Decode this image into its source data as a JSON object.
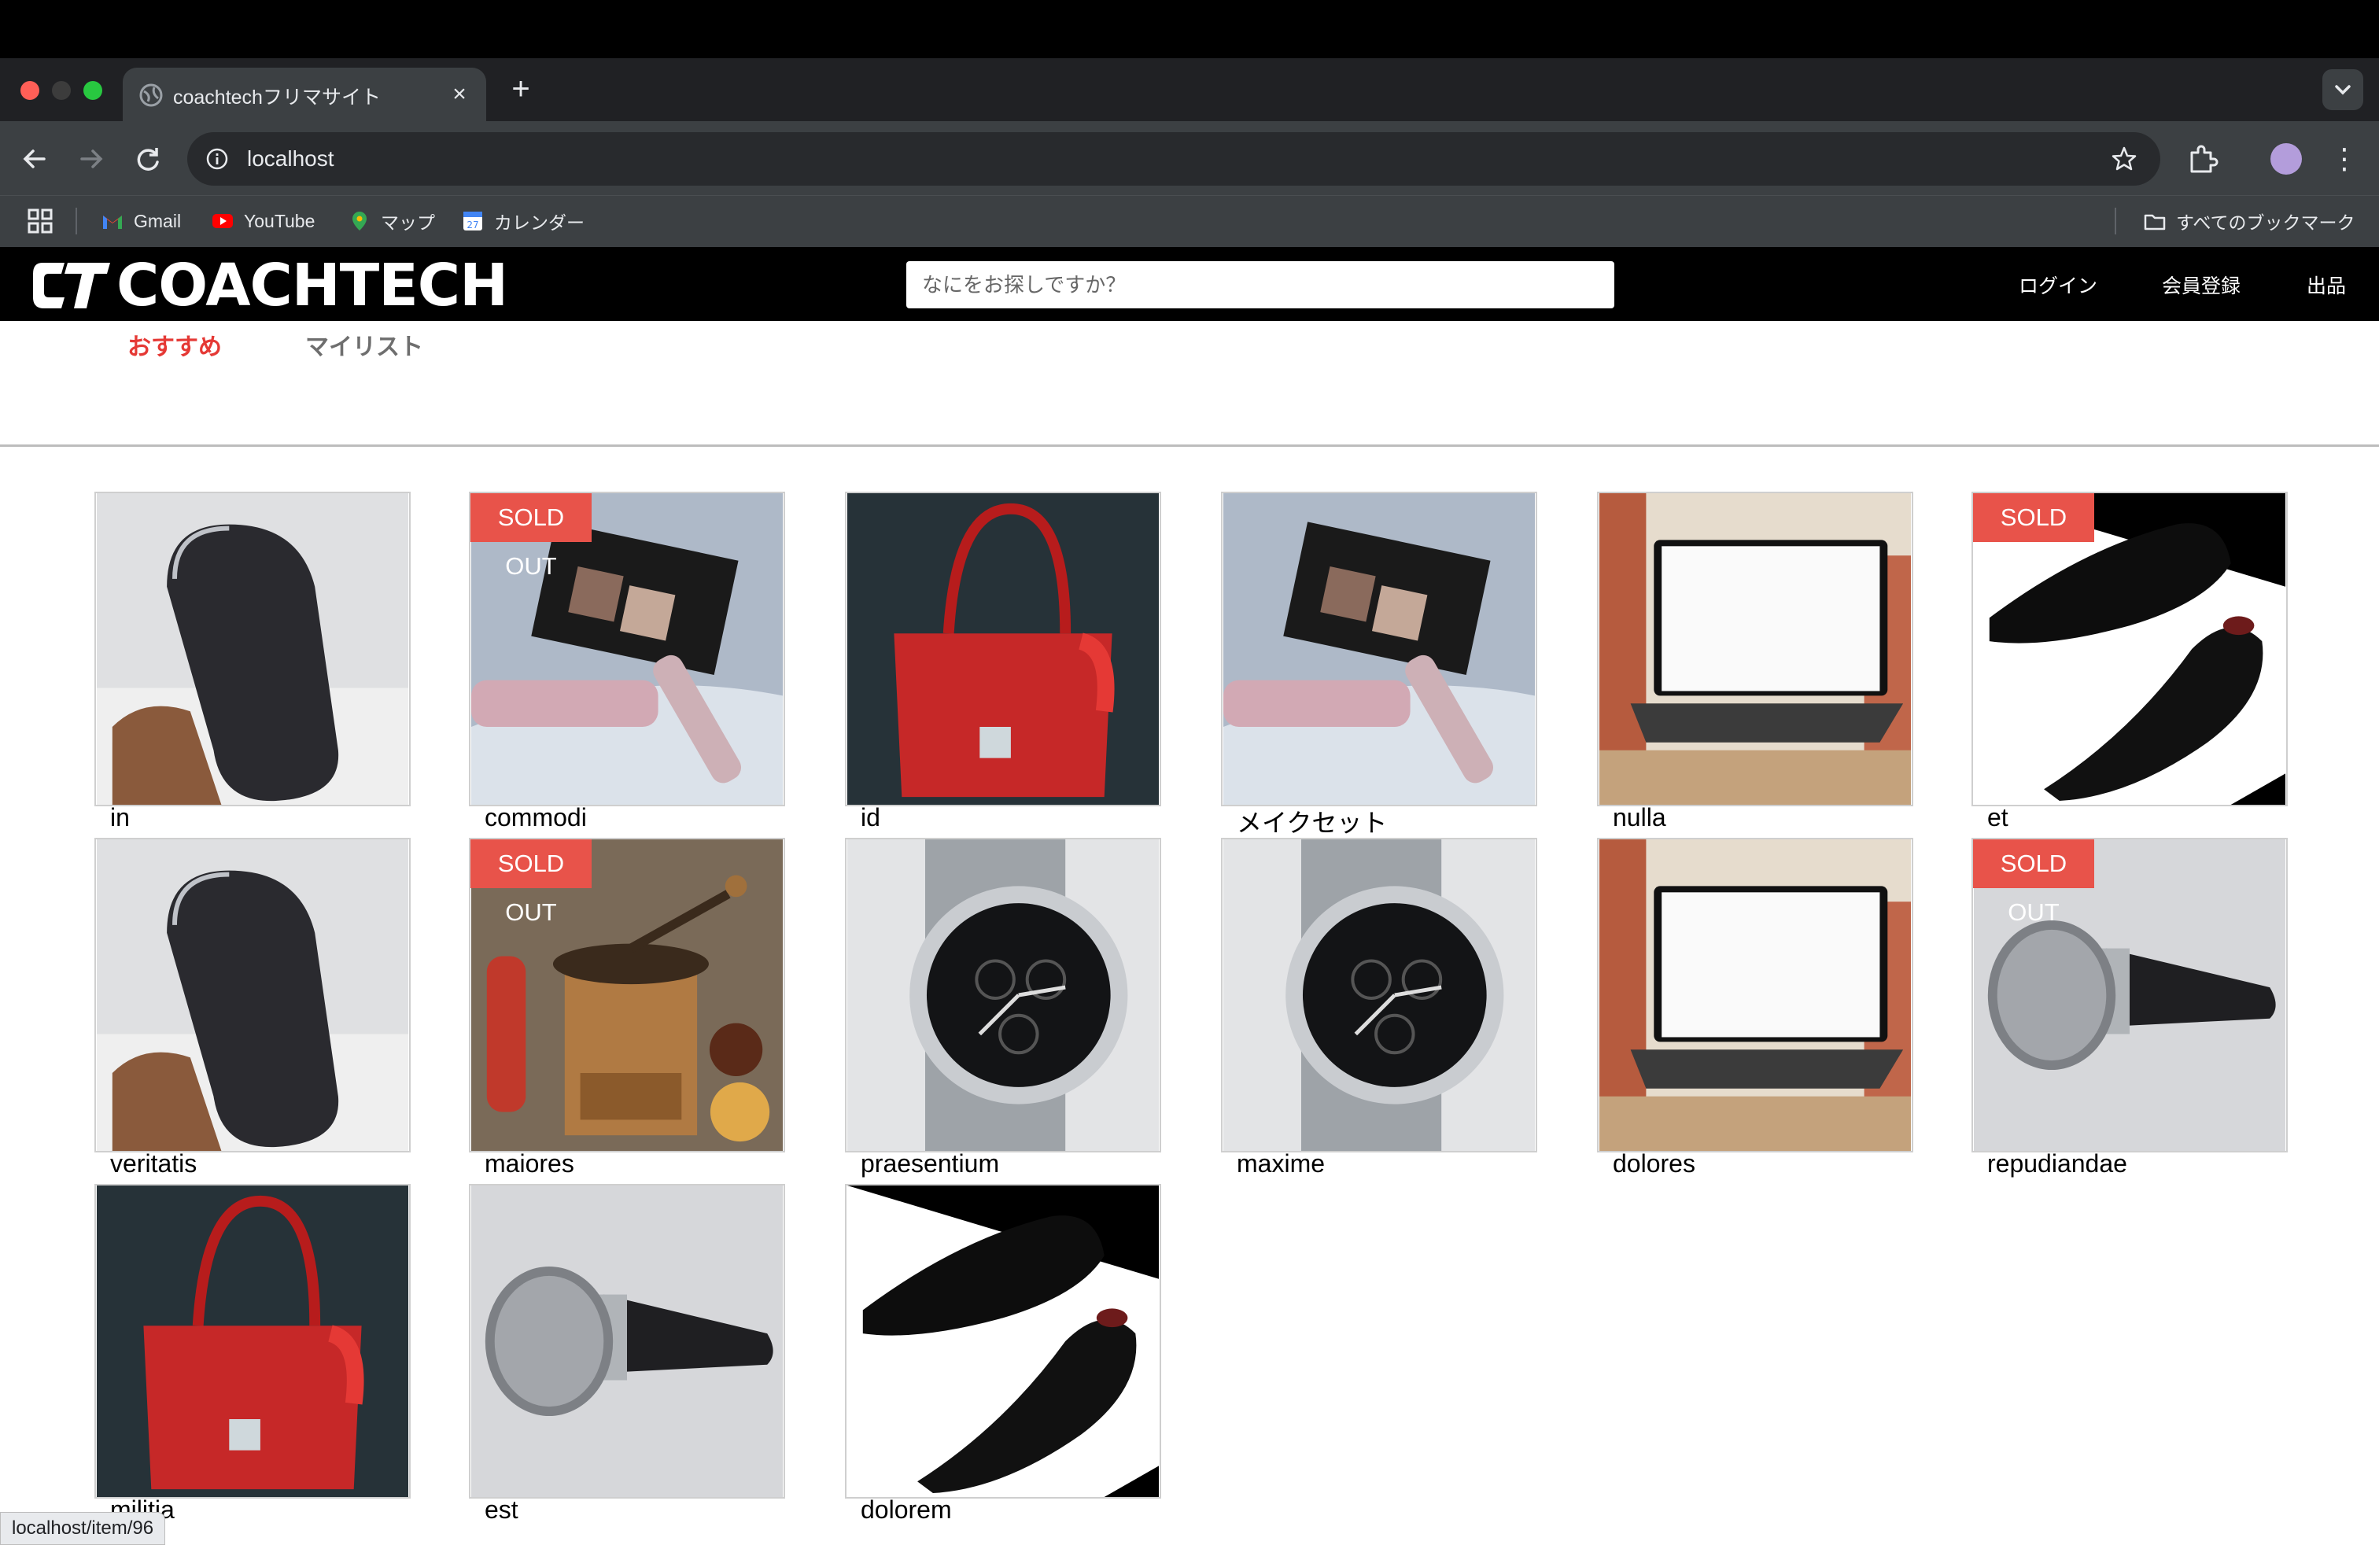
{
  "browser": {
    "tab_title": "coachtechフリマサイト",
    "url": "localhost",
    "bookmarks": [
      {
        "label": "Gmail",
        "icon": "gmail-icon"
      },
      {
        "label": "YouTube",
        "icon": "youtube-icon"
      },
      {
        "label": "マップ",
        "icon": "maps-icon"
      },
      {
        "label": "カレンダー",
        "icon": "calendar-icon"
      }
    ],
    "all_bookmarks": "すべてのブックマーク",
    "status_url": "localhost/item/96"
  },
  "site": {
    "logo_text": "COACHTECH",
    "search_placeholder": "なにをお探しですか？",
    "nav": {
      "login": "ログイン",
      "register": "会員登録",
      "sell": "出品"
    },
    "tabs": {
      "recommend": "おすすめ",
      "mylist": "マイリスト"
    },
    "sold_label": "SOLD OUT",
    "accent": "#e53935",
    "items": [
      {
        "name": "in",
        "image": "tumbler",
        "sold": false
      },
      {
        "name": "commodi",
        "image": "makeup",
        "sold": true
      },
      {
        "name": "id",
        "image": "red-bag",
        "sold": false
      },
      {
        "name": "メイクセット",
        "image": "makeup",
        "sold": false
      },
      {
        "name": "nulla",
        "image": "laptop",
        "sold": false
      },
      {
        "name": "et",
        "image": "shoes",
        "sold": true
      },
      {
        "name": "veritatis",
        "image": "tumbler",
        "sold": false
      },
      {
        "name": "maiores",
        "image": "coffee-grinder",
        "sold": true
      },
      {
        "name": "praesentium",
        "image": "watch",
        "sold": false
      },
      {
        "name": "maxime",
        "image": "watch",
        "sold": false
      },
      {
        "name": "dolores",
        "image": "laptop",
        "sold": false
      },
      {
        "name": "repudiandae",
        "image": "microphone",
        "sold": true
      },
      {
        "name": "militia",
        "image": "red-bag",
        "sold": false
      },
      {
        "name": "est",
        "image": "microphone",
        "sold": false
      },
      {
        "name": "dolorem",
        "image": "shoes",
        "sold": false
      }
    ]
  }
}
